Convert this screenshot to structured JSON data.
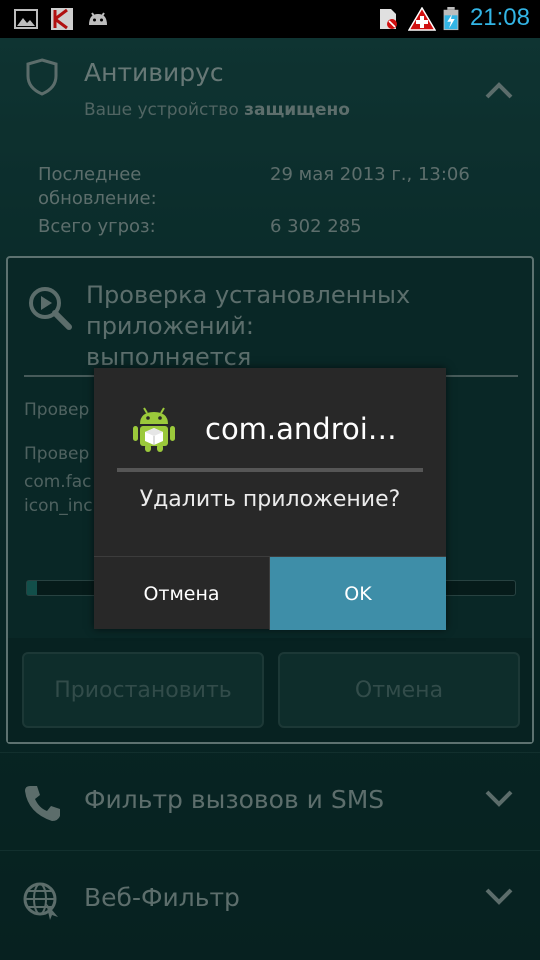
{
  "status_bar": {
    "time": "21:08",
    "icons": [
      "image-icon",
      "kaspersky-icon",
      "android-debug-icon",
      "sd-card-icon",
      "swiss-flag-icon",
      "battery-charging-icon"
    ]
  },
  "antivirus": {
    "title": "Антивирус",
    "subtitle_prefix": "Ваше устройство ",
    "subtitle_status": "защищено",
    "last_update_label_1": "Последнее",
    "last_update_label_2": "обновление:",
    "last_update_value": "29 мая 2013 г., 13:06",
    "threats_label": "Всего угроз:",
    "threats_value": "6 302 285"
  },
  "scan": {
    "title_line1": "Проверка установленных",
    "title_line2": "приложений:",
    "title_line3": "выполняется",
    "line1": "Провер",
    "line2": "Провер",
    "line3": "com.fac",
    "line4": "icon_inc",
    "pause_label": "Приостановить",
    "cancel_label": "Отмена",
    "progress": 0.02
  },
  "list": {
    "calls_label": "Фильтр вызовов и SMS",
    "web_label": "Веб-Фильтр"
  },
  "dialog": {
    "title": "com.androi…",
    "message": "Удалить приложение?",
    "cancel": "Отмена",
    "ok": "OK"
  },
  "colors": {
    "accent": "#33b5e5",
    "dialog_ok": "#3e8ea8",
    "panel_bg": "#0f3d3b"
  }
}
